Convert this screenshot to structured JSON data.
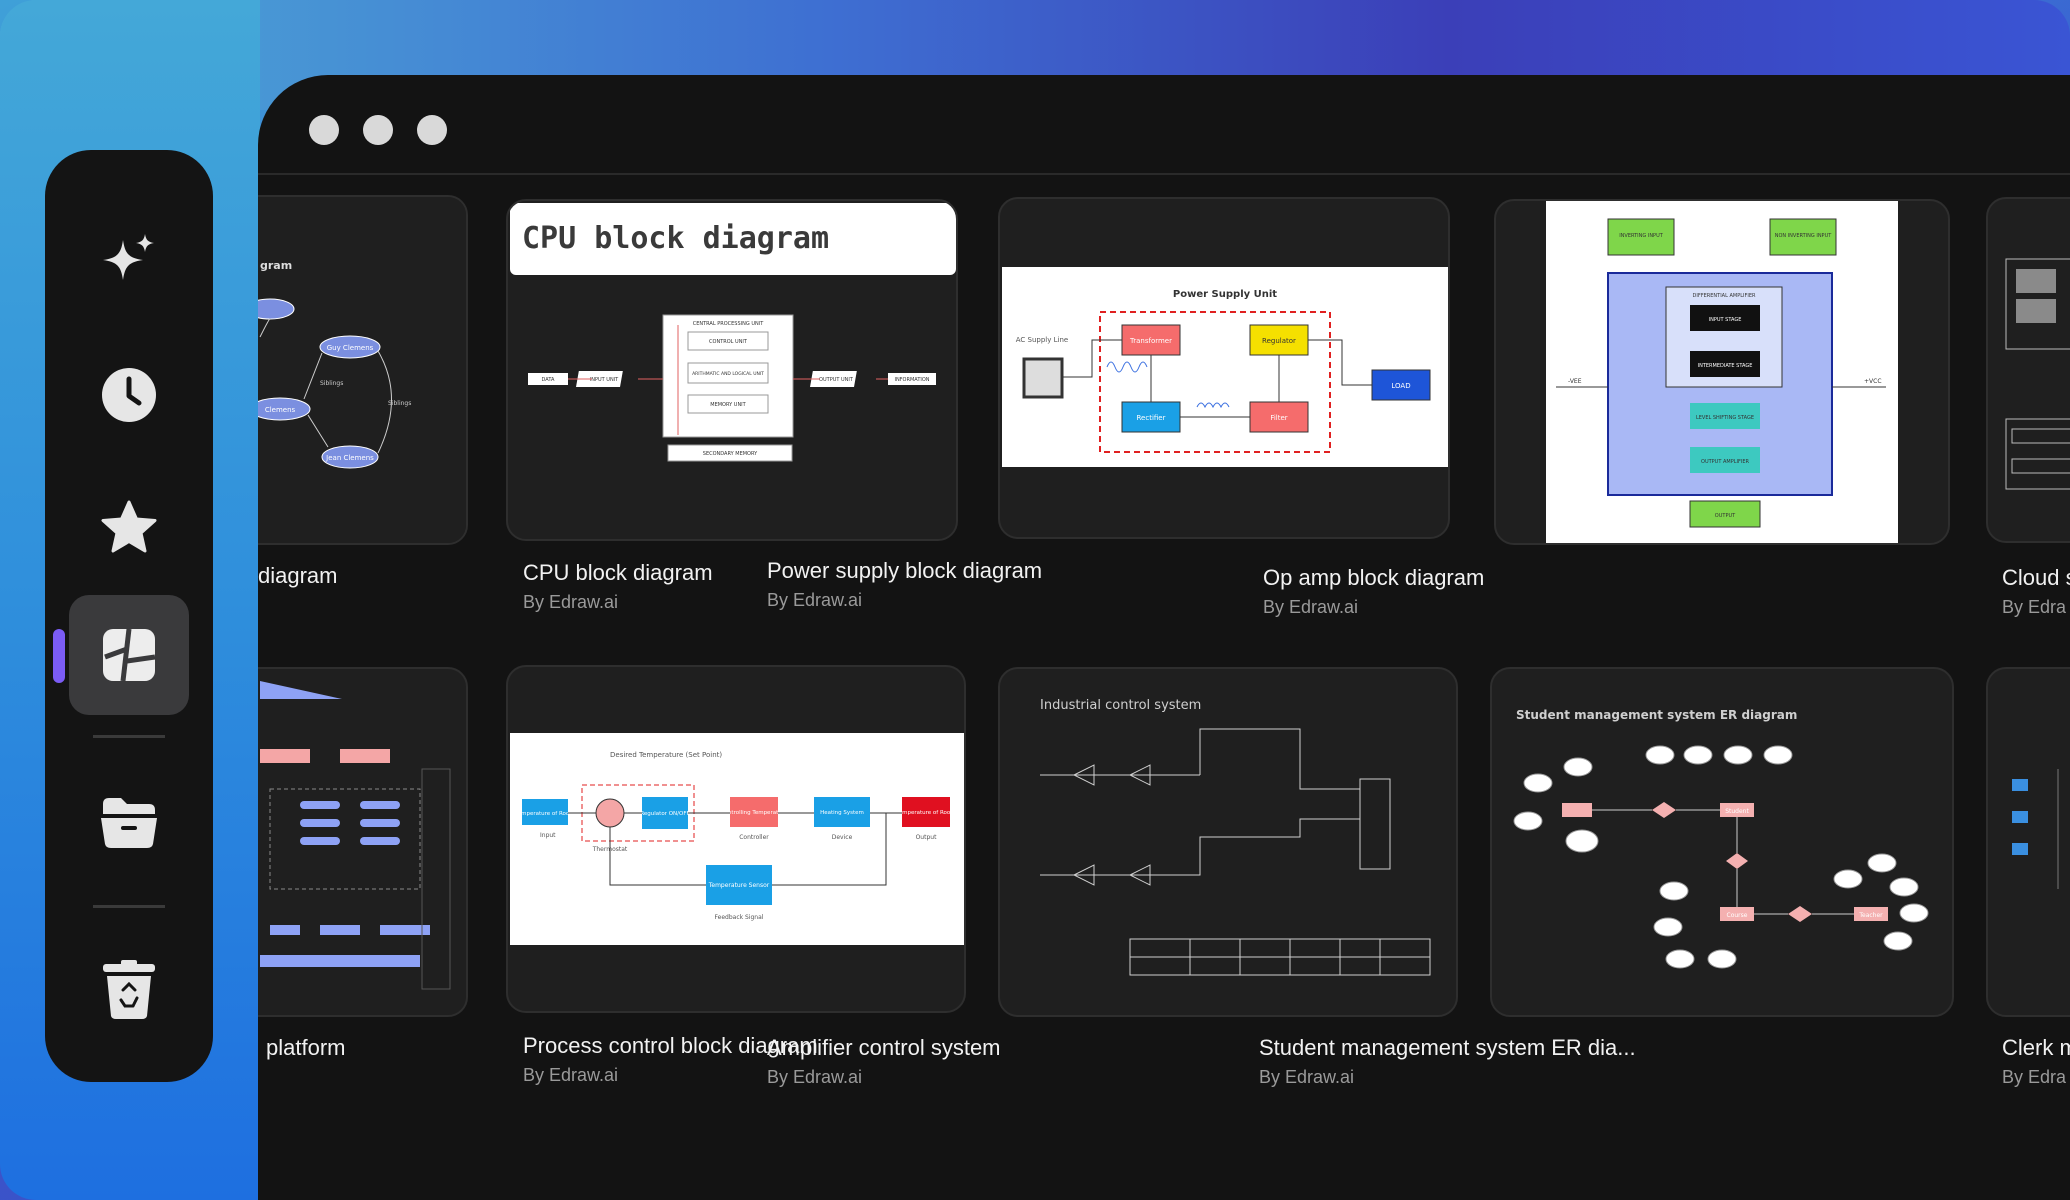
{
  "window": {
    "controls": [
      "close",
      "minimize",
      "maximize"
    ]
  },
  "sidebar": {
    "items": [
      {
        "name": "ai-sparkle-icon",
        "label": ""
      },
      {
        "name": "recent-clock-icon",
        "label": ""
      },
      {
        "name": "favorites-star-icon",
        "label": ""
      },
      {
        "name": "templates-icon",
        "label": "",
        "active": true
      },
      {
        "name": "folder-icon",
        "label": ""
      },
      {
        "name": "recycle-bin-icon",
        "label": ""
      }
    ],
    "accent": "#7b5cf5"
  },
  "templates": {
    "row1": [
      {
        "title": "diagram",
        "author": "",
        "thumb_title": "gram"
      },
      {
        "title": "CPU block diagram",
        "author": "By Edraw.ai",
        "thumb_title": "CPU block diagram"
      },
      {
        "title": "Power supply block diagram",
        "author": "By Edraw.ai",
        "thumb_title": "Power Supply Unit"
      },
      {
        "title": "Op amp block diagram",
        "author": "By Edraw.ai",
        "thumb_title": ""
      },
      {
        "title": "Cloud s",
        "author": "By Edra",
        "thumb_title": ""
      }
    ],
    "row2": [
      {
        "title": "platform",
        "author": "",
        "thumb_title": ""
      },
      {
        "title": "Process control block diagram",
        "author": "By Edraw.ai",
        "thumb_title": "Desired Temperature (Set Point)"
      },
      {
        "title": "Amplifier control system",
        "author": "By Edraw.ai",
        "thumb_title": "Industrial control system"
      },
      {
        "title": "Student management system ER dia...",
        "author": "By Edraw.ai",
        "thumb_title": "Student management system ER diagram"
      },
      {
        "title": "Clerk m",
        "author": "By Edra",
        "thumb_title": ""
      }
    ]
  },
  "thumb_labels": {
    "cpu": {
      "cpu": "CENTRAL PROCESSING UNIT",
      "control": "CONTROL UNIT",
      "alu": "ARITHMATIC AND LOGICAL UNIT",
      "memory": "MEMORY UNIT",
      "data": "DATA",
      "input": "INPUT UNIT",
      "output": "OUTPUT UNIT",
      "info": "INFORMATION",
      "secondary": "SECONDARY MEMORY"
    },
    "power": {
      "ac": "AC Supply Line",
      "transformer": "Transformer",
      "regulator": "Regulator",
      "rectifier": "Rectifier",
      "filter": "Filter",
      "load": "LOAD"
    },
    "opamp": {
      "inv": "INVERTING INPUT",
      "noninv": "NON INVERTING INPUT",
      "diff": "DIFFERENTIAL AMPLIFIER",
      "input_stage": "INPUT STAGE",
      "intermediate": "INTERMEDIATE STAGE",
      "level": "LEVEL SHIFTING STAGE",
      "out_amp": "OUTPUT AMPLIFIER",
      "output": "OUTPUT",
      "vee": "-VEE",
      "vcc": "+VCC"
    },
    "process": {
      "input_label": "Input",
      "temp_room": "Temperature of Room",
      "regulator": "Regulator ON/OFF",
      "controlling": "Controlling Temperature",
      "heating": "Heating System",
      "temp_out": "Temperature of Room",
      "sensor": "Temperature Sensor",
      "thermostat": "Thermostat",
      "controller": "Controller",
      "device": "Device",
      "output_label": "Output",
      "feedback": "Feedback Signal"
    },
    "er": {
      "student": "Student",
      "course": "Course",
      "teacher": "Teacher"
    },
    "family": {
      "node1": "Guy Clemens",
      "node2": "Clemens",
      "node3": "Jean Clemens",
      "sib": "Siblings"
    }
  },
  "colors": {
    "card_bg": "#1f1f1f",
    "window_bg": "#131313",
    "title_text": "#f2f2f2",
    "author_text": "#9a9a9a"
  }
}
